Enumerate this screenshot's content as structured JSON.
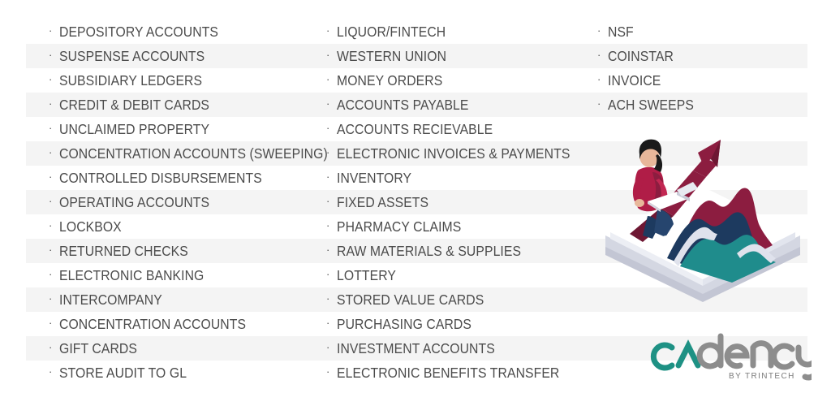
{
  "page": {
    "background_color": "#ffffff",
    "stripe_color": "#f4f4f4",
    "text_color": "#4b4b4b",
    "bullet_glyph": "·"
  },
  "columns": [
    {
      "name": "column-1",
      "items": [
        "DEPOSITORY ACCOUNTS",
        "SUSPENSE ACCOUNTS",
        "SUBSIDIARY LEDGERS",
        "CREDIT & DEBIT CARDS",
        "UNCLAIMED PROPERTY",
        "CONCENTRATION ACCOUNTS (SWEEPING)",
        "CONTROLLED DISBURSEMENTS",
        "OPERATING ACCOUNTS",
        "LOCKBOX",
        "RETURNED CHECKS",
        "ELECTRONIC BANKING",
        "INTERCOMPANY",
        "CONCENTRATION ACCOUNTS",
        "GIFT CARDS",
        "STORE AUDIT TO GL"
      ]
    },
    {
      "name": "column-2",
      "items": [
        "LIQUOR/FINTECH",
        "WESTERN UNION",
        "MONEY ORDERS",
        "ACCOUNTS PAYABLE",
        "ACCOUNTS RECIEVABLE",
        "ELECTRONIC INVOICES & PAYMENTS",
        "INVENTORY",
        "FIXED ASSETS",
        "PHARMACY CLAIMS",
        "RAW MATERIALS & SUPPLIES",
        "LOTTERY",
        "STORED VALUE CARDS",
        "PURCHASING CARDS",
        "INVESTMENT ACCOUNTS",
        "ELECTRONIC BENEFITS TRANSFER"
      ]
    },
    {
      "name": "column-3",
      "items": [
        "NSF",
        "COINSTAR",
        "INVOICE",
        "ACH SWEEPS"
      ]
    }
  ],
  "illustration": {
    "name": "isometric-analyst-on-growth-arrow",
    "arrow_color": "#8c1d40",
    "arrow_shade_color": "#6e1733",
    "wave_teal": "#1f8c8c",
    "wave_navy": "#1d3a5f",
    "wave_maroon": "#8c1d40",
    "platform_color": "#ffffff",
    "platform_shadow_color": "#c3c6d4",
    "figure_top_color": "#b01d47",
    "figure_pants_color": "#1d3a5f",
    "figure_hair_color": "#1a1a1a",
    "figure_skin_color": "#e8b79a",
    "laptop_color": "#f4f5f8"
  },
  "logo": {
    "name": "cadency-by-trintech-logo",
    "wordmark_accent": "cA",
    "wordmark_rest": "dency",
    "tagline": "BY TRINTECH",
    "accent_color": "#1e9184",
    "gray_color": "#8d8d8d",
    "tagline_color": "#7b7b7b"
  }
}
